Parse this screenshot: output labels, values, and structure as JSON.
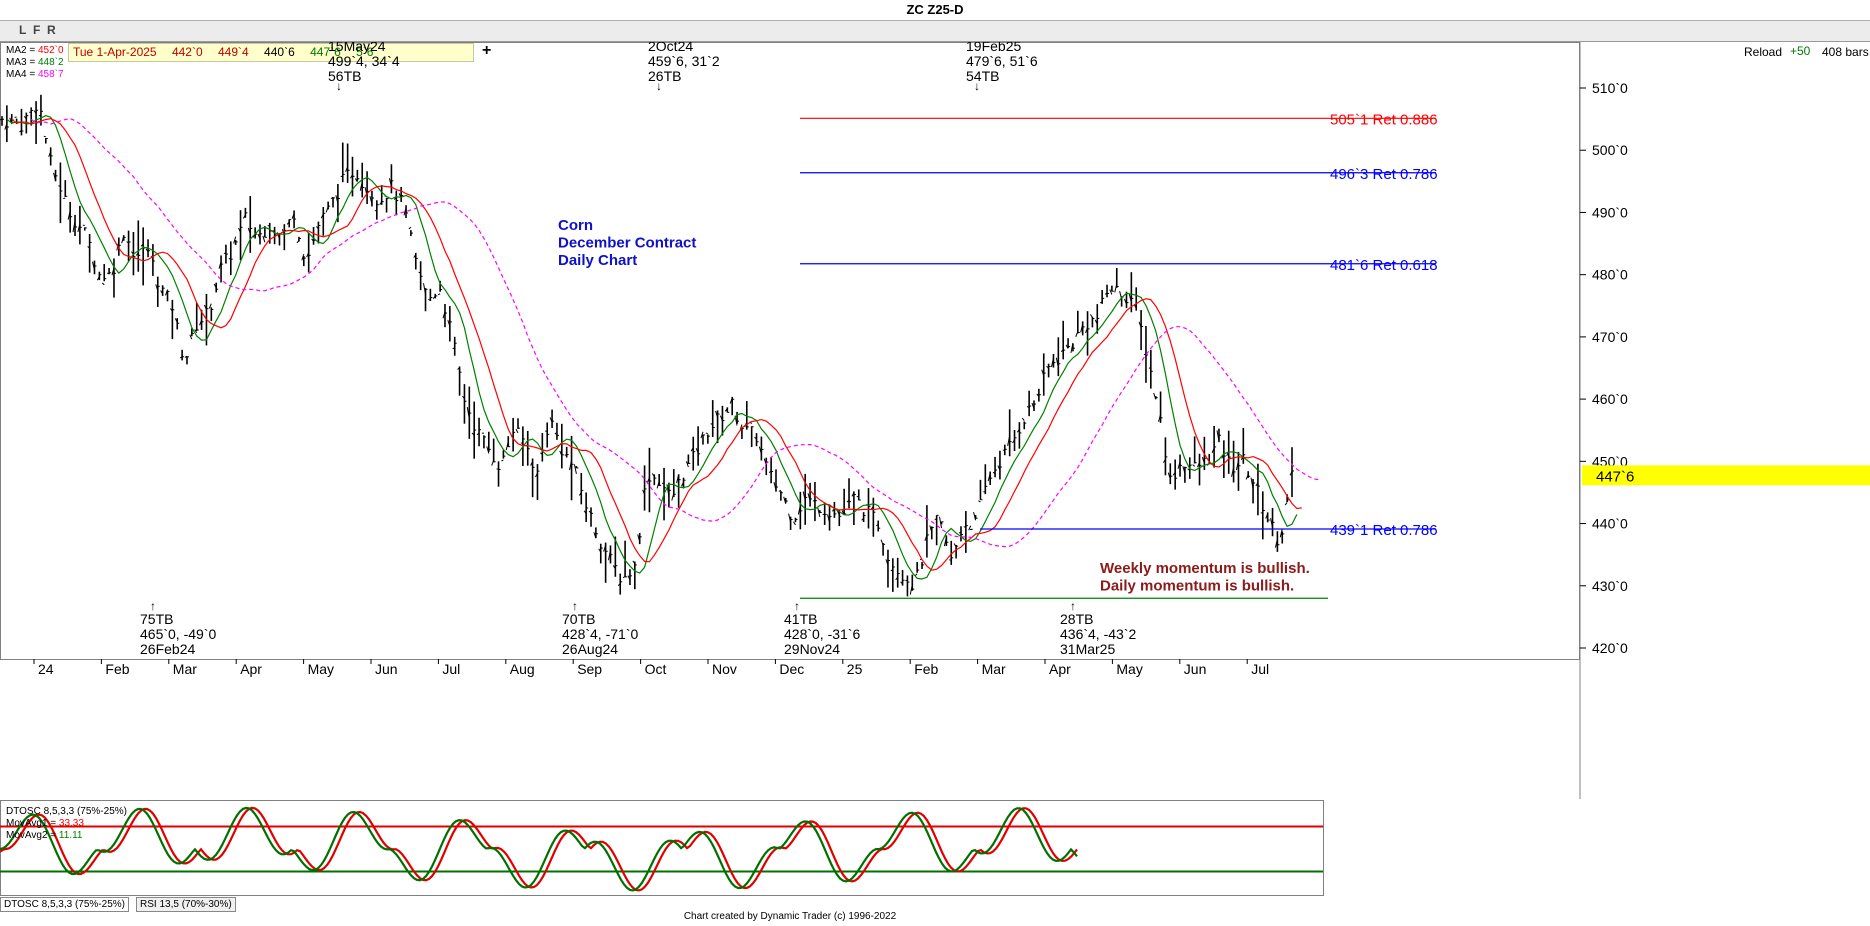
{
  "window": {
    "title": "ZC Z25-D"
  },
  "toolbar": {
    "buttons": [
      "L",
      "F",
      "R"
    ],
    "info": {
      "date": "Tue 1-Apr-2025",
      "open": "442`0",
      "high": "449`4",
      "low": "440`6",
      "close": "447`6",
      "change": "5`6"
    },
    "reload_label": "Reload",
    "plus_label": "+50",
    "bars_label": "408 bars",
    "add_label": "+"
  },
  "legend": {
    "ma2": {
      "label": "MA2 = ",
      "value": "452`0",
      "color": "#ff0000"
    },
    "ma3": {
      "label": "MA3 = ",
      "value": "448`2",
      "color": "#008000"
    },
    "ma4": {
      "label": "MA4 = ",
      "value": "458`7",
      "color": "#ff00ff"
    }
  },
  "chart_data": {
    "type": "bar",
    "title": "ZC Z25-D",
    "subtitle_lines": [
      "Corn",
      "December Contract",
      "Daily Chart"
    ],
    "price_scale": {
      "min": 420,
      "max": 510,
      "ticks": [
        "510`0",
        "500`0",
        "490`0",
        "480`0",
        "470`0",
        "460`0",
        "450`0",
        "440`0",
        "430`0",
        "420`0"
      ],
      "tick_values": [
        510,
        500,
        490,
        480,
        470,
        460,
        450,
        440,
        430,
        420
      ]
    },
    "x_axis_labels": [
      "24",
      "Feb",
      "Mar",
      "Apr",
      "May",
      "Jun",
      "Jul",
      "Aug",
      "Sep",
      "Oct",
      "Nov",
      "Dec",
      "25",
      "Feb",
      "Mar",
      "Apr",
      "May",
      "Jun",
      "Jul"
    ],
    "current_price": {
      "label": "447`6",
      "value": 447.75
    },
    "retracement_levels": [
      {
        "label": "505`1 Ret 0.886",
        "value": 505.125,
        "color": "#ff0000"
      },
      {
        "label": "496`3 Ret 0.786",
        "value": 496.375,
        "color": "#0000ff"
      },
      {
        "label": "481`6 Ret 0.618",
        "value": 481.75,
        "color": "#0000ff"
      },
      {
        "label": "439`1 Ret 0.786",
        "value": 439.125,
        "color": "#0000ff"
      }
    ],
    "support_level": {
      "value": 428.0,
      "color": "#008000"
    },
    "pivots": [
      {
        "type": "high",
        "lines": [
          "15May24",
          "499`4, 34`4",
          "56TB"
        ],
        "price": 499.5
      },
      {
        "type": "high",
        "lines": [
          "2Oct24",
          "459`6, 31`2",
          "26TB"
        ],
        "price": 459.75
      },
      {
        "type": "high",
        "lines": [
          "19Feb25",
          "479`6, 51`6",
          "54TB"
        ],
        "price": 479.75
      },
      {
        "type": "low",
        "lines": [
          "75TB",
          "465`0, -49`0",
          "26Feb24"
        ],
        "price": 465.0
      },
      {
        "type": "low",
        "lines": [
          "70TB",
          "428`4, -71`0",
          "26Aug24"
        ],
        "price": 428.5
      },
      {
        "type": "low",
        "lines": [
          "41TB",
          "428`0, -31`6",
          "29Nov24"
        ],
        "price": 428.0
      },
      {
        "type": "low",
        "lines": [
          "28TB",
          "436`4, -43`2",
          "31Mar25"
        ],
        "price": 436.5
      }
    ],
    "momentum_notes": [
      "Weekly momentum is bullish.",
      "Daily momentum is bullish."
    ],
    "series": [
      {
        "name": "MA2",
        "color": "#ff0000"
      },
      {
        "name": "MA3",
        "color": "#008000"
      },
      {
        "name": "MA4",
        "color": "#ff00ff"
      }
    ],
    "close_path": [
      [
        0,
        505
      ],
      [
        8,
        504
      ],
      [
        15,
        508
      ],
      [
        20,
        498
      ],
      [
        28,
        490
      ],
      [
        35,
        486
      ],
      [
        40,
        480
      ],
      [
        45,
        480
      ],
      [
        50,
        487
      ],
      [
        55,
        483
      ],
      [
        60,
        484
      ],
      [
        65,
        478
      ],
      [
        70,
        475
      ],
      [
        75,
        466
      ],
      [
        80,
        472
      ],
      [
        85,
        474
      ],
      [
        90,
        481
      ],
      [
        95,
        484
      ],
      [
        100,
        489
      ],
      [
        105,
        486
      ],
      [
        110,
        488
      ],
      [
        115,
        486
      ],
      [
        120,
        490
      ],
      [
        125,
        482
      ],
      [
        130,
        488
      ],
      [
        135,
        491
      ],
      [
        140,
        495
      ],
      [
        145,
        497
      ],
      [
        150,
        494
      ],
      [
        155,
        492
      ],
      [
        160,
        494
      ],
      [
        165,
        491
      ],
      [
        170,
        482
      ],
      [
        175,
        476
      ],
      [
        180,
        478
      ],
      [
        185,
        470
      ],
      [
        190,
        460
      ],
      [
        195,
        455
      ],
      [
        200,
        452
      ],
      [
        205,
        449
      ],
      [
        210,
        455
      ],
      [
        215,
        453
      ],
      [
        220,
        448
      ],
      [
        225,
        457
      ],
      [
        230,
        452
      ],
      [
        235,
        449
      ],
      [
        240,
        443
      ],
      [
        245,
        438
      ],
      [
        250,
        434
      ],
      [
        255,
        431
      ],
      [
        260,
        433
      ],
      [
        265,
        448
      ],
      [
        270,
        447
      ],
      [
        275,
        444
      ],
      [
        280,
        448
      ],
      [
        285,
        451
      ],
      [
        290,
        455
      ],
      [
        295,
        457
      ],
      [
        300,
        459
      ],
      [
        305,
        455
      ],
      [
        310,
        454
      ],
      [
        315,
        448
      ],
      [
        320,
        445
      ],
      [
        325,
        441
      ],
      [
        330,
        444
      ],
      [
        335,
        443
      ],
      [
        340,
        442
      ],
      [
        345,
        441
      ],
      [
        350,
        444
      ],
      [
        355,
        442
      ],
      [
        360,
        440
      ],
      [
        365,
        434
      ],
      [
        370,
        432
      ],
      [
        375,
        430
      ],
      [
        380,
        437
      ],
      [
        385,
        441
      ],
      [
        390,
        434
      ],
      [
        395,
        440
      ],
      [
        400,
        440
      ],
      [
        405,
        447
      ],
      [
        410,
        450
      ],
      [
        415,
        453
      ],
      [
        420,
        457
      ],
      [
        425,
        460
      ],
      [
        430,
        465
      ],
      [
        435,
        467
      ],
      [
        440,
        469
      ],
      [
        445,
        472
      ],
      [
        450,
        473
      ],
      [
        455,
        478
      ],
      [
        460,
        477
      ],
      [
        465,
        476
      ],
      [
        470,
        468
      ],
      [
        475,
        459
      ],
      [
        480,
        447
      ],
      [
        485,
        450
      ],
      [
        490,
        449
      ],
      [
        495,
        450
      ],
      [
        500,
        453
      ],
      [
        505,
        449
      ],
      [
        510,
        450
      ],
      [
        515,
        446
      ],
      [
        520,
        441
      ],
      [
        525,
        437
      ],
      [
        530,
        447.75
      ]
    ],
    "osc_levels": {
      "upper": 75,
      "lower": 25
    }
  },
  "oscillator": {
    "title": "DTOSC 8,5,3,3 (75%-25%)",
    "mov1": {
      "label": "MovAvg1 = ",
      "value": "33.33",
      "color": "#ff0000"
    },
    "mov2": {
      "label": "MovAvg2 = ",
      "value": "11.11",
      "color": "#008000"
    }
  },
  "tabs": [
    "DTOSC 8,5,3,3 (75%-25%)",
    "RSI 13,5 (70%-30%)"
  ],
  "footer": "Chart created by Dynamic Trader  (c) 1996-2022"
}
